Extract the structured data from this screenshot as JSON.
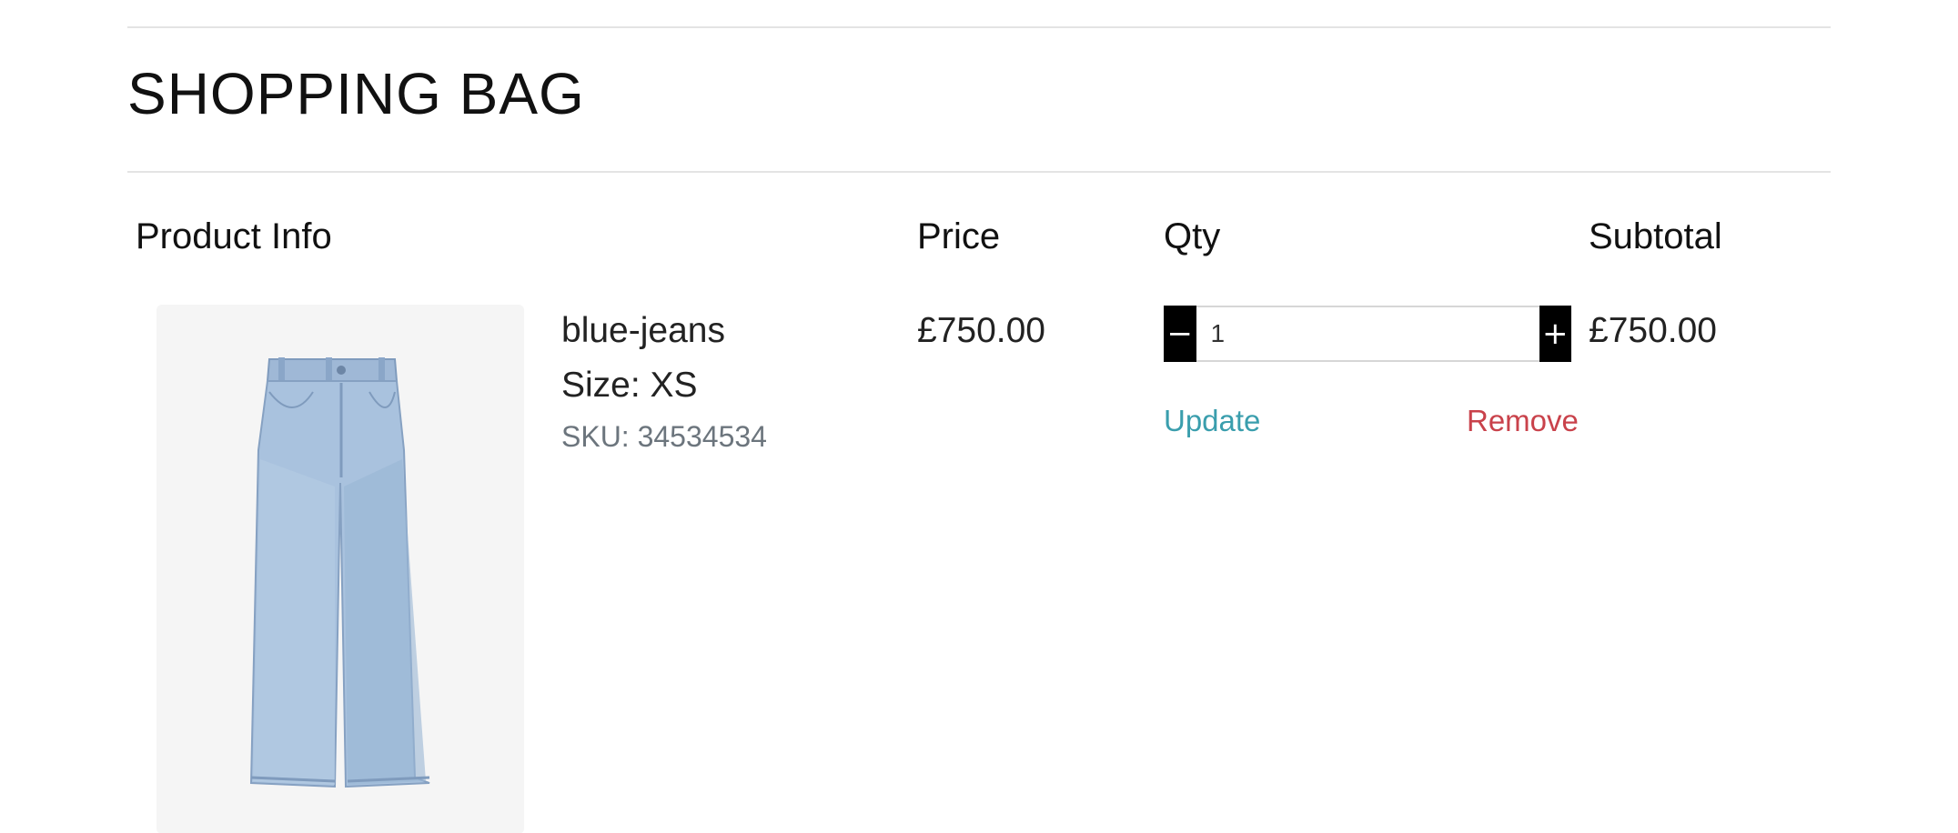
{
  "page": {
    "title": "SHOPPING BAG"
  },
  "table": {
    "headers": {
      "product": "Product Info",
      "price": "Price",
      "qty": "Qty",
      "subtotal": "Subtotal"
    }
  },
  "item": {
    "name": "blue-jeans",
    "size": "Size: XS",
    "sku": "SKU: 34534534",
    "price": "£750.00",
    "subtotal": "£750.00",
    "qty": "1",
    "decrement_label": "−",
    "increment_label": "+",
    "update_label": "Update",
    "remove_label": "Remove",
    "image_icon": "jeans-product-image"
  },
  "colors": {
    "update_link": "#3a9ead",
    "remove_link": "#c9424b",
    "qty_buttons": "#000000",
    "thumb_bg": "#f5f5f5"
  }
}
